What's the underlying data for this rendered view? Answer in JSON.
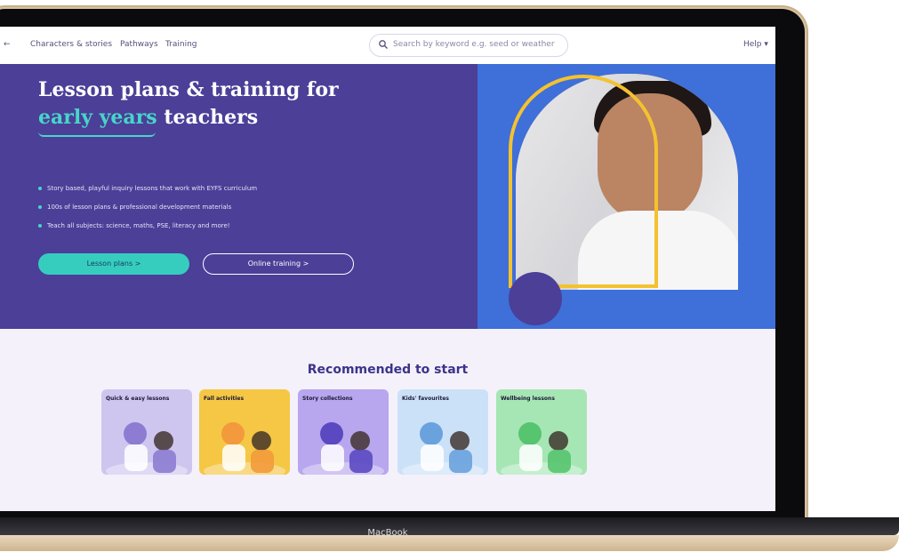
{
  "nav": {
    "links": [
      "Characters & stories",
      "Pathways",
      "Training"
    ],
    "left_stub": "← ",
    "search_placeholder": "Search by keyword e.g. seed or weather",
    "right": "Help ▾"
  },
  "hero": {
    "title_line1": "Lesson plans & training for",
    "title_accent": "early years",
    "title_rest": " teachers",
    "bullets": [
      "Story based, playful inquiry lessons that work with EYFS curriculum",
      "100s of lesson plans & professional development materials",
      "Teach all subjects: science, maths, PSE, literacy and more!"
    ],
    "primary_button": "Lesson plans  >",
    "secondary_button": "Online training  >"
  },
  "recommended": {
    "heading": "Recommended to start",
    "cards": [
      {
        "label": "Quick & easy lessons",
        "bg": "#cfc6f0",
        "art": "#8d7cd2"
      },
      {
        "label": "Fall activities",
        "bg": "#f5c744",
        "art": "#f29a3c"
      },
      {
        "label": "Story collections",
        "bg": "#b8a6ee",
        "art": "#5b49c2"
      },
      {
        "label": "Kids' favourites",
        "bg": "#cbe1f8",
        "art": "#6aa2dd"
      },
      {
        "label": "Wellbeing lessons",
        "bg": "#a6e6b4",
        "art": "#57c46f"
      }
    ]
  },
  "device": {
    "label": "MacBook"
  },
  "colors": {
    "hero_bg": "#4b3f98",
    "hero_right": "#3f6fd8",
    "accent": "#48d5c8",
    "frame": "#f4c22f"
  }
}
